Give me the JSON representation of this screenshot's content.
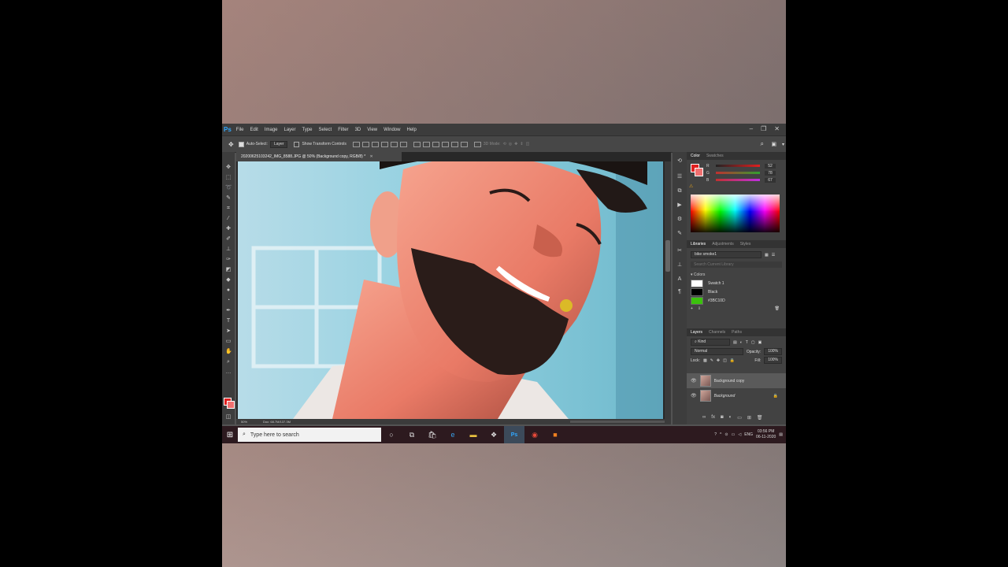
{
  "app": {
    "logo": "Ps",
    "menu": [
      "File",
      "Edit",
      "Image",
      "Layer",
      "Type",
      "Select",
      "Filter",
      "3D",
      "View",
      "Window",
      "Help"
    ]
  },
  "options": {
    "auto_select_label": "Auto-Select:",
    "auto_select_value": "Layer",
    "show_transform_label": "Show Transform Controls",
    "mode_3d_label": "3D Mode:"
  },
  "document": {
    "tab_title": "20200625103242_IMG_8588.JPG @ 50% (Background copy, RGB/8) *",
    "zoom": "50%",
    "doc_size": "Doc: 68.7M/137.3M"
  },
  "colors": {
    "foreground": "#e02020",
    "background": "#f07070",
    "accent": "#31a8ff"
  },
  "color_panel": {
    "tab_color": "Color",
    "tab_swatches": "Swatches",
    "r_label": "R",
    "g_label": "G",
    "b_label": "B",
    "r_value": "52",
    "g_value": "78",
    "b_value": "67"
  },
  "libraries_panel": {
    "tab_libraries": "Libraries",
    "tab_adjustments": "Adjustments",
    "tab_styles": "Styles",
    "library_name": "bike smoke1",
    "search_placeholder": "Search Current Library",
    "colors_heading": "Colors",
    "swatches": [
      {
        "name": "Swatch 1",
        "color": "#ffffff"
      },
      {
        "name": "Black",
        "color": "#000000"
      },
      {
        "name": "#3BC10D",
        "color": "#3bc10d"
      }
    ]
  },
  "layers_panel": {
    "tab_layers": "Layers",
    "tab_channels": "Channels",
    "tab_paths": "Paths",
    "kind_label": "Kind",
    "blend_mode": "Normal",
    "opacity_label": "Opacity:",
    "opacity_value": "100%",
    "lock_label": "Lock:",
    "fill_label": "Fill:",
    "fill_value": "100%",
    "layers": [
      {
        "name": "Background copy"
      },
      {
        "name": "Background"
      }
    ]
  },
  "taskbar": {
    "search_placeholder": "Type here to search",
    "language": "ENG",
    "time": "03:56 PM",
    "date": "06-11-2020"
  }
}
